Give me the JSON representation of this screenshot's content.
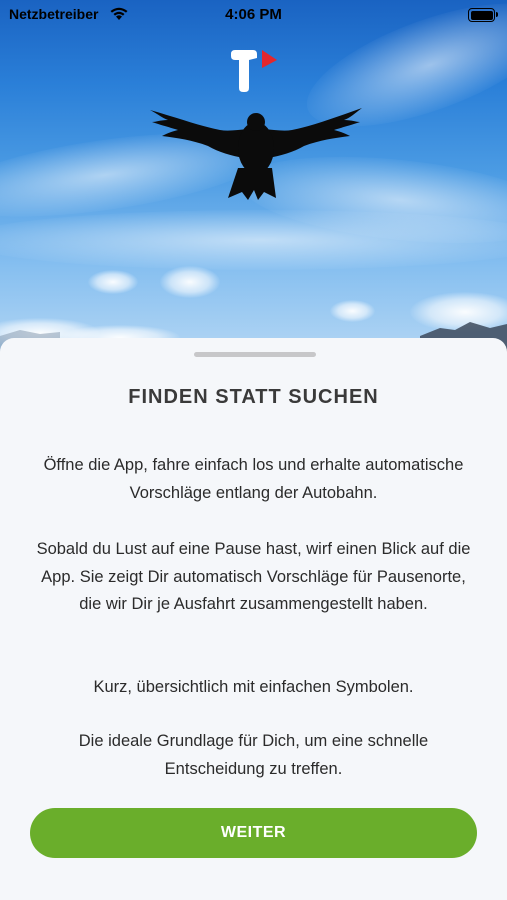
{
  "status_bar": {
    "carrier": "Netzbetreiber",
    "time": "4:06 PM",
    "wifi_icon": "wifi-icon",
    "battery_icon": "battery-icon"
  },
  "hero": {
    "logo_icon": "app-logo-icon",
    "image": "bird-in-sky"
  },
  "sheet": {
    "title": "FINDEN STATT SUCHEN",
    "paragraphs": [
      "Öffne die App, fahre einfach los und erhalte automatische Vorschläge entlang der Autobahn.",
      "Sobald du Lust auf eine Pause hast, wirf einen Blick auf die App. Sie zeigt Dir automatisch Vorschläge für Pausenorte, die wir Dir je Ausfahrt zusammengestellt haben.",
      "Kurz, übersichtlich mit einfachen Symbolen.",
      "Die ideale Grundlage für Dich, um eine schnelle Entscheidung zu treffen."
    ],
    "button_label": "WEITER"
  },
  "colors": {
    "accent": "#6aae2b",
    "sheet_bg": "#f5f7fa",
    "logo_red": "#e3262c"
  }
}
